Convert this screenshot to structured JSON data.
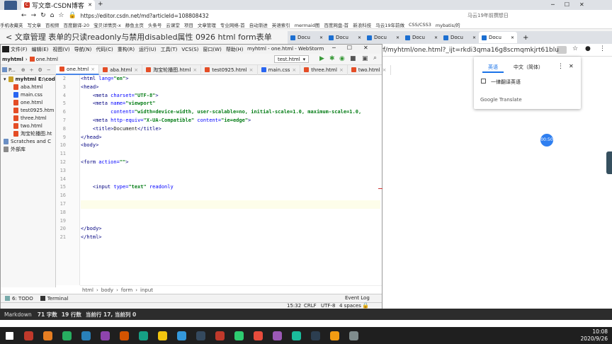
{
  "browser": {
    "tab_title": "写文章-CSDN博客",
    "url": "https://editor.csdn.net/md?articleId=108808432",
    "bookmarks": [
      "手机收藏夹",
      "写文章",
      "百视频",
      "百度翻译-20",
      "宝贝详情页-x",
      "静鱼主页",
      "头条号",
      "云课堂",
      "项目",
      "文章管理",
      "专业网络-首",
      "自动渐进",
      "英语索引",
      "mermaid图",
      "百度网盘-首",
      "新浪科技",
      "马云19年前做",
      "CSS/CSS3",
      "mybatis/的"
    ],
    "csdn_bar_text": "< 文章管理  表单的只读readonly与禁用disabled属性 0926 html form表单",
    "search_hint": "马云19年前撰想日"
  },
  "chrome2": {
    "tabs": [
      "Docu",
      "Docu",
      "Docu",
      "Docu",
      "Docu",
      "Docu"
    ],
    "url": "rf/myhtml/one.html?_ijt=rkdi3qma16g8scmqmkjrt61blu"
  },
  "translate": {
    "source_lang": "英语",
    "target_lang": "中文（简体）",
    "option": "一律翻译英语",
    "brand": "Google Translate"
  },
  "ide": {
    "menus": [
      "文件(F)",
      "编辑(E)",
      "视图(V)",
      "导航(N)",
      "代码(C)",
      "重构(R)",
      "运行(U)",
      "工具(T)",
      "VCS(S)",
      "窗口(W)",
      "帮助(H)"
    ],
    "window_title": "myhtml - one.html - WebStorm",
    "project_name": "myhtml",
    "open_file": "one.html",
    "run_config": "test.html",
    "project_label": "P...",
    "tree": [
      {
        "label": "myhtml E:\\cod",
        "indent": 0,
        "kind": "folder"
      },
      {
        "label": "aba.html",
        "indent": 1,
        "kind": "html"
      },
      {
        "label": "main.css",
        "indent": 1,
        "kind": "css"
      },
      {
        "label": "one.html",
        "indent": 1,
        "kind": "html"
      },
      {
        "label": "test0925.htm",
        "indent": 1,
        "kind": "html"
      },
      {
        "label": "three.html",
        "indent": 1,
        "kind": "html"
      },
      {
        "label": "two.html",
        "indent": 1,
        "kind": "html"
      },
      {
        "label": "淘宝轮播图.ht",
        "indent": 1,
        "kind": "html"
      },
      {
        "label": "Scratches and C",
        "indent": 0,
        "kind": "scratch"
      },
      {
        "label": "外部库",
        "indent": 0,
        "kind": "lib"
      }
    ],
    "tabs": [
      "one.html",
      "aba.html",
      "淘宝轮播图.html",
      "test0925.html",
      "main.css",
      "three.html",
      "two.html"
    ],
    "code_lines": [
      {
        "n": "2",
        "html": "<span class='tg'>&lt;html </span><span class='at'>lang=</span><span class='vl'>\"en\"</span><span class='tg'>&gt;</span>"
      },
      {
        "n": "3",
        "html": "<span class='tg'>&lt;head&gt;</span>"
      },
      {
        "n": "4",
        "html": "    <span class='tg'>&lt;meta </span><span class='at'>charset=</span><span class='vl'>\"UTF-8\"</span><span class='tg'>&gt;</span>"
      },
      {
        "n": "5",
        "html": "    <span class='tg'>&lt;meta </span><span class='at'>name=</span><span class='vl'>\"viewport\"</span>"
      },
      {
        "n": "6",
        "html": "          <span class='at'>content=</span><span class='vl'>\"width=device-width, user-scalable=no, initial-scale=1.0, maximum-scale=1.0,</span>"
      },
      {
        "n": "7",
        "html": "    <span class='tg'>&lt;meta </span><span class='at'>http-equiv=</span><span class='vl'>\"X-UA-Compatible\"</span> <span class='at'>content=</span><span class='vl'>\"ie=edge\"</span><span class='tg'>&gt;</span>"
      },
      {
        "n": "8",
        "html": "    <span class='tg'>&lt;title&gt;</span>Document<span class='tg'>&lt;/title&gt;</span>"
      },
      {
        "n": "9",
        "html": "<span class='tg'>&lt;/head&gt;</span>"
      },
      {
        "n": "10",
        "html": "<span class='tg'>&lt;body&gt;</span>"
      },
      {
        "n": "11",
        "html": ""
      },
      {
        "n": "12",
        "html": "<span class='tg'>&lt;form </span><span class='at'>action=</span><span class='vl'>\"\"</span><span class='tg'>&gt;</span>"
      },
      {
        "n": "13",
        "html": ""
      },
      {
        "n": "14",
        "html": ""
      },
      {
        "n": "15",
        "html": "    <span class='tg'>&lt;input </span><span class='at'>type=</span><span class='vl'>\"text\"</span> <span class='at'>readonly</span>"
      },
      {
        "n": "16",
        "html": ""
      },
      {
        "n": "17",
        "html": "<span class='tg'>&lt;/form&gt;</span>"
      },
      {
        "n": "18",
        "html": ""
      },
      {
        "n": "19",
        "html": ""
      },
      {
        "n": "20",
        "html": "<span class='tg'>&lt;/body&gt;</span>"
      },
      {
        "n": "21",
        "html": "<span class='tg'>&lt;/html&gt;</span>"
      }
    ],
    "breadcrumb": [
      "html",
      "body",
      "form",
      "input"
    ],
    "tool_windows": [
      "6: TODO",
      "Terminal"
    ],
    "event_log": "Event Log",
    "status": {
      "pos": "15:32",
      "eol": "CRLF",
      "enc": "UTF-8",
      "indent": "4 spaces"
    }
  },
  "markdown_bar": {
    "mode": "Markdown",
    "chars": "71 字数",
    "lines": "19 行数",
    "cur": "当前行 17, 当前列 0"
  },
  "recording": {
    "time": "00:50"
  },
  "taskbar": {
    "time": "10:08",
    "date": "2020/9/26",
    "apps": [
      "#c0392b",
      "#e67e22",
      "#27ae60",
      "#2980b9",
      "#8e44ad",
      "#d35400",
      "#16a085",
      "#f1c40f",
      "#3498db",
      "#34495e",
      "#c0392b",
      "#2ecc71",
      "#e74c3c",
      "#9b59b6",
      "#1abc9c",
      "#2c3e50",
      "#f39c12",
      "#7f8c8d"
    ]
  }
}
